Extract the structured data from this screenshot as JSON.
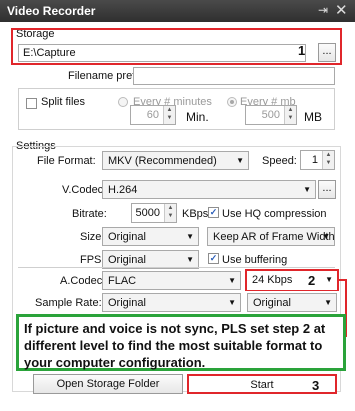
{
  "window": {
    "title": "Video Recorder",
    "pin_icon": "pin-icon",
    "close_icon": "close-icon"
  },
  "storage": {
    "group_label": "Storage",
    "path_value": "E:\\Capture",
    "marker": "1",
    "browse_label": "...",
    "filename_prefix_label": "Filename prefix:",
    "filename_prefix_value": ""
  },
  "split": {
    "split_files_label": "Split files",
    "split_files_checked": false,
    "every_minutes_label": "Every # minutes",
    "every_mb_label": "Every # mb",
    "minutes_value": "60",
    "minutes_unit": "Min.",
    "mb_value": "500",
    "mb_unit": "MB"
  },
  "settings": {
    "group_label": "Settings",
    "file_format_label": "File Format:",
    "file_format_value": "MKV (Recommended)",
    "speed_label": "Speed:",
    "speed_value": "1",
    "vcodec_label": "V.Codec:",
    "vcodec_value": "H.264",
    "vcodec_more": "...",
    "bitrate_label": "Bitrate:",
    "bitrate_value": "5000",
    "bitrate_unit": "KBps",
    "use_hq_label": "Use HQ compression",
    "size_label": "Size:",
    "size_value": "Original",
    "keep_ar_value": "Keep AR of Frame Width (Re",
    "fps_label": "FPS:",
    "fps_value": "Original",
    "use_buffering_label": "Use buffering",
    "acodec_label": "A.Codec:",
    "acodec_value": "FLAC",
    "abitrate_value": "24 Kbps",
    "marker2": "2",
    "sample_rate_label": "Sample Rate:",
    "sample_rate_value": "Original",
    "channels_value": "Original"
  },
  "note": {
    "text": "If picture and voice is not sync, PLS set step 2 at different level to find the most suitable format to your computer configuration."
  },
  "actions": {
    "open_folder_label": "Open Storage Folder",
    "start_label": "Start",
    "marker3": "3"
  },
  "colors": {
    "highlight_red": "#e0262b",
    "highlight_green": "#2aa33a",
    "titlebar": "#3a3a3a"
  }
}
